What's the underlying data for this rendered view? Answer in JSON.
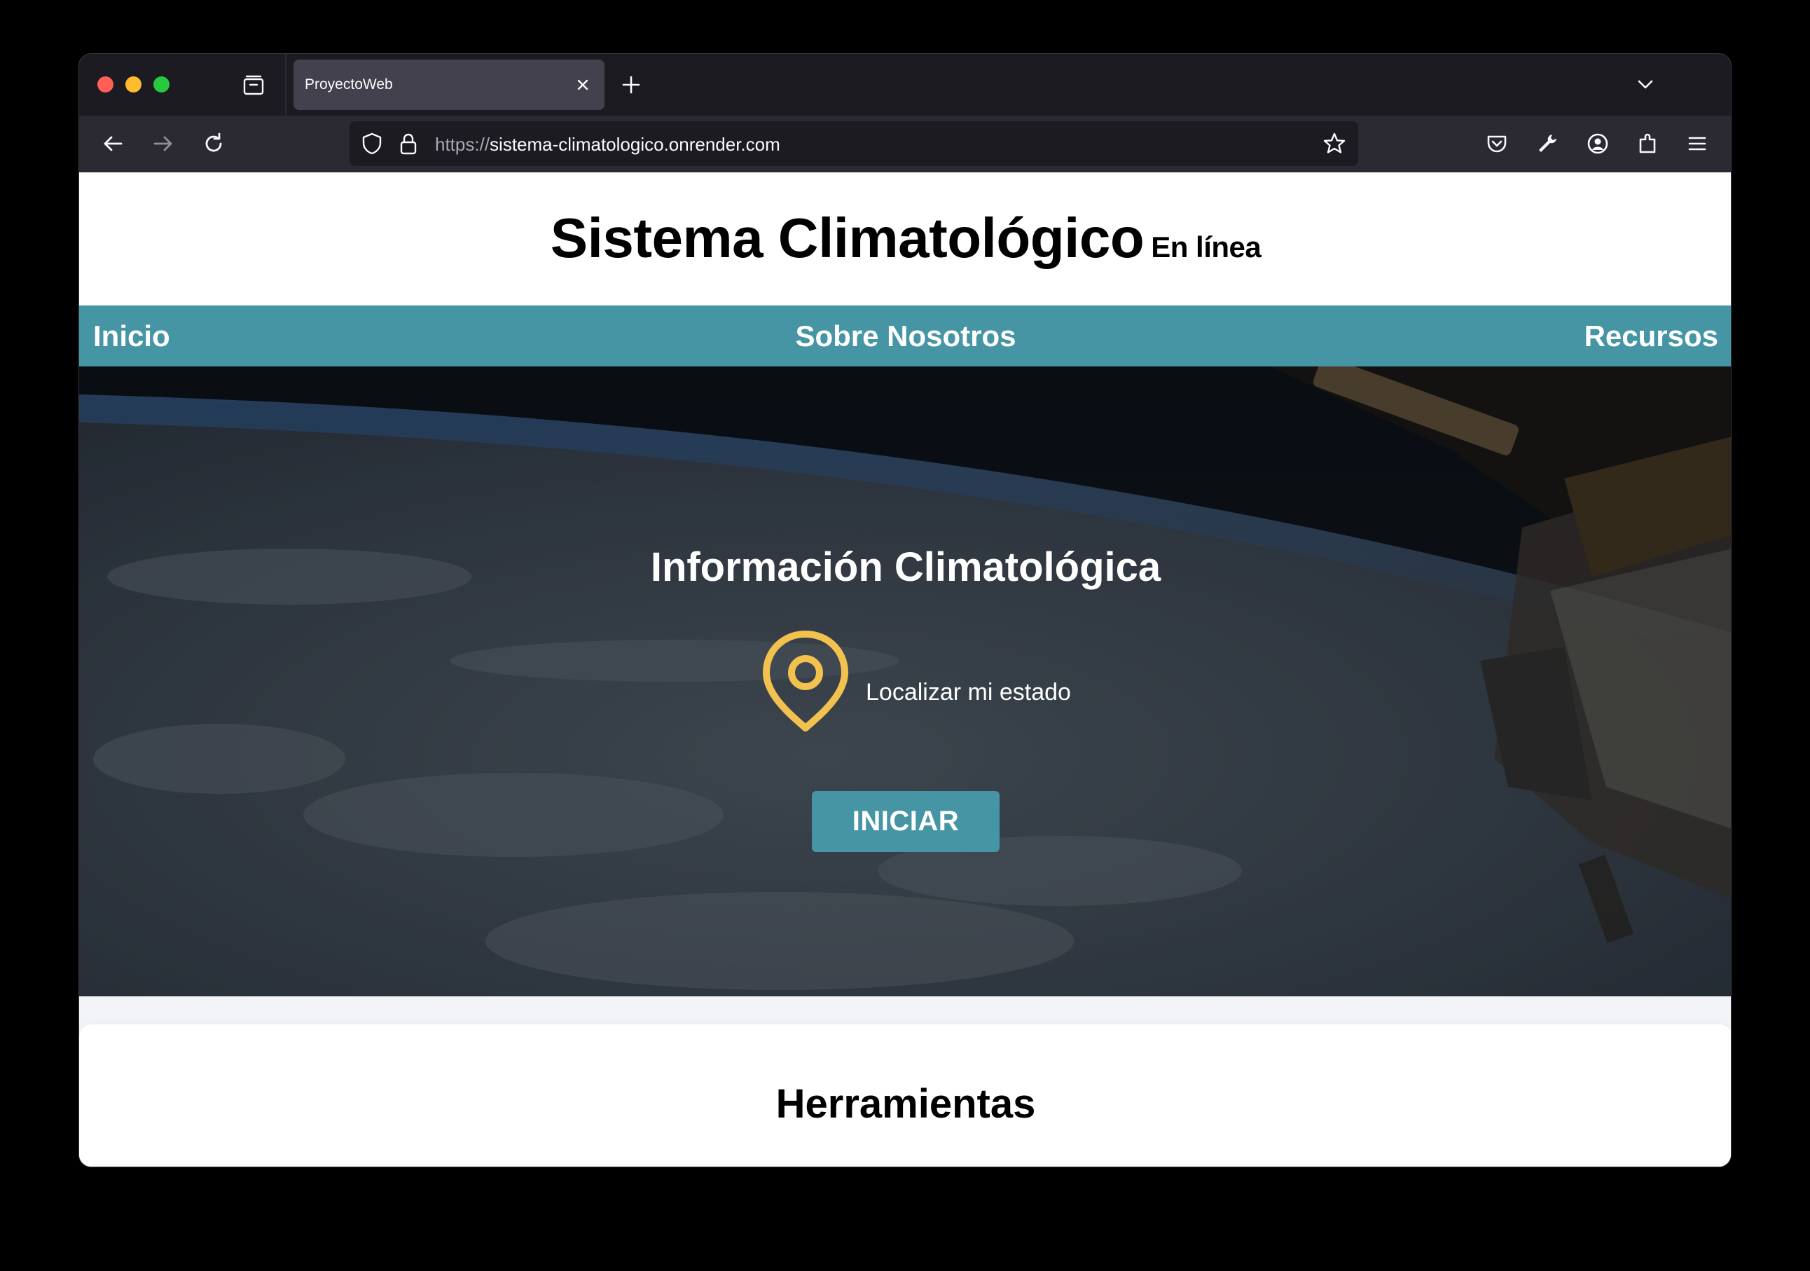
{
  "browser": {
    "tab_title": "ProyectoWeb",
    "url_scheme": "https://",
    "url_host": "sistema-climatologico.onrender.com",
    "icons": [
      "tab-overview-icon",
      "close-icon",
      "plus-icon",
      "chevron-down-icon",
      "back-arrow-icon",
      "forward-arrow-icon",
      "reload-icon",
      "shield-icon",
      "lock-icon",
      "star-icon",
      "pocket-icon",
      "wrench-icon",
      "account-icon",
      "extensions-icon",
      "menu-icon"
    ]
  },
  "site": {
    "title": "Sistema Climatológico",
    "title_suffix": "En línea",
    "nav": {
      "inicio": "Inicio",
      "sobre": "Sobre Nosotros",
      "recursos": "Recursos"
    },
    "hero": {
      "heading": "Información Climatológica",
      "locate_label": "Localizar mi estado",
      "start_button": "INICIAR"
    },
    "tools_heading": "Herramientas"
  },
  "colors": {
    "accent": "#4595a4",
    "pin": "#f2c14e",
    "browser_chrome": "#2b2a33"
  }
}
